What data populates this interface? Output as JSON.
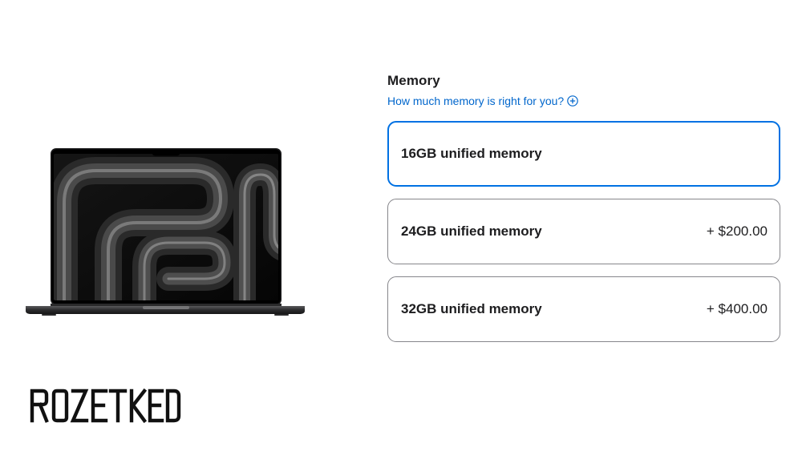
{
  "memory": {
    "title": "Memory",
    "help_link": "How much memory is right for you?",
    "options": [
      {
        "label": "16GB unified memory",
        "price": "",
        "selected": true
      },
      {
        "label": "24GB unified memory",
        "price": "+ $200.00",
        "selected": false
      },
      {
        "label": "32GB unified memory",
        "price": "+ $400.00",
        "selected": false
      }
    ]
  },
  "watermark": {
    "text": "ROZETKED"
  },
  "colors": {
    "link": "#0066cc",
    "selected_border": "#0071e3",
    "border": "#86868b",
    "text": "#1d1d1f"
  },
  "icons": {
    "help": "plus-circle-icon",
    "product": "laptop-image"
  }
}
